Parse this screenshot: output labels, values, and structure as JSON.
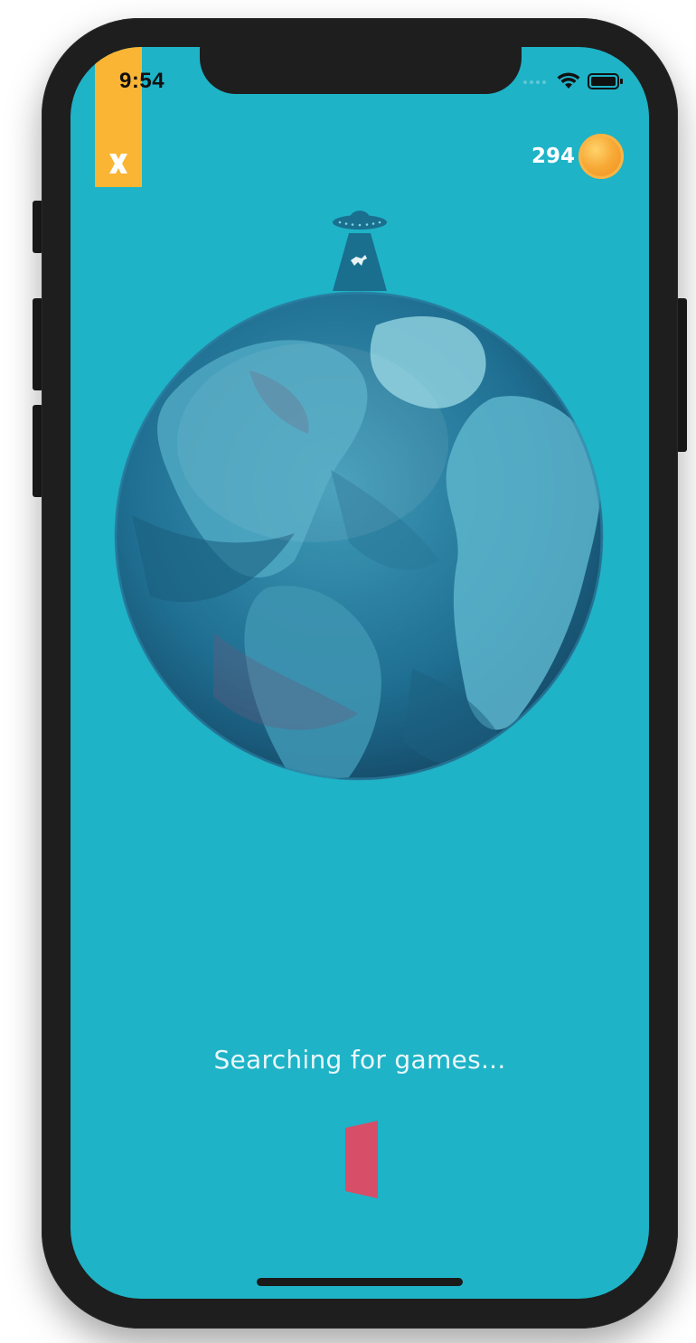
{
  "status_bar": {
    "time": "9:54",
    "signal_icon": "signal-dots-icon",
    "wifi_icon": "wifi-icon",
    "battery_icon": "battery-icon"
  },
  "close_button": {
    "icon": "close-icon",
    "color": "#fbb535"
  },
  "coins": {
    "count": "294",
    "icon": "coin-icon"
  },
  "illustration": {
    "ufo_icon": "ufo-icon",
    "globe_icon": "globe-icon"
  },
  "status": {
    "text": "Searching for games..."
  },
  "loader": {
    "icon": "flipping-card-loader-icon",
    "color": "#d64e68"
  },
  "theme": {
    "background": "#1fb3c8"
  }
}
